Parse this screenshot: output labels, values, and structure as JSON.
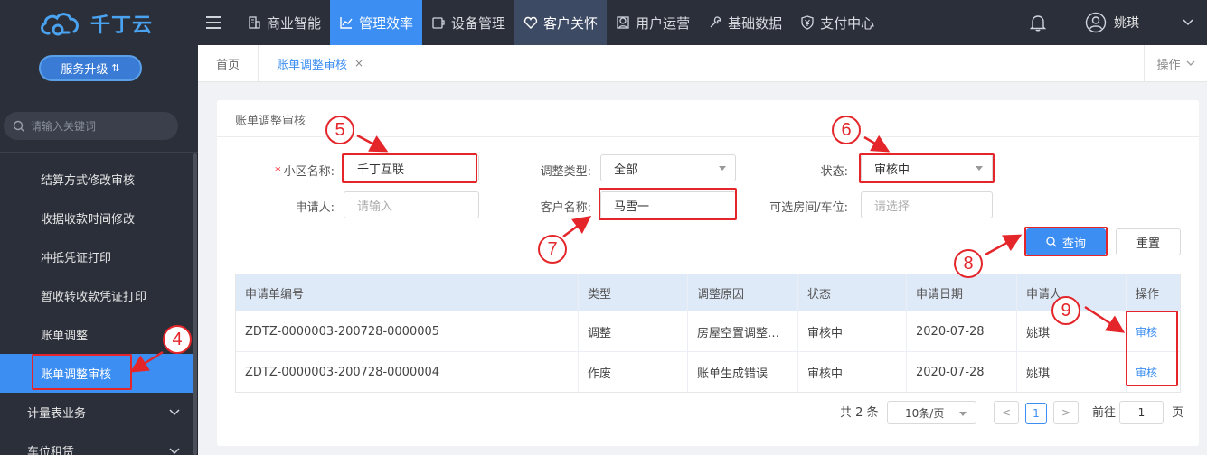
{
  "brand": {
    "logo_text": "千丁云",
    "upgrade_label": "服务升级"
  },
  "sidebar": {
    "search_placeholder": "请输入关键词",
    "items": [
      {
        "label": "结算方式修改审核"
      },
      {
        "label": "收据收款时间修改"
      },
      {
        "label": "冲抵凭证打印"
      },
      {
        "label": "暂收转收款凭证打印"
      },
      {
        "label": "账单调整"
      },
      {
        "label": "账单调整审核"
      }
    ],
    "groups": [
      {
        "label": "计量表业务"
      },
      {
        "label": "车位租赁"
      }
    ]
  },
  "topnav": {
    "items": [
      {
        "label": "商业智能",
        "icon": "building-icon"
      },
      {
        "label": "管理效率",
        "icon": "chart-icon"
      },
      {
        "label": "设备管理",
        "icon": "device-icon"
      },
      {
        "label": "客户关怀",
        "icon": "heart-icon"
      },
      {
        "label": "用户运营",
        "icon": "user-ops-icon"
      },
      {
        "label": "基础数据",
        "icon": "wrench-icon"
      },
      {
        "label": "支付中心",
        "icon": "yen-shield-icon"
      }
    ],
    "user_name": "姚琪"
  },
  "tabs": {
    "items": [
      {
        "label": "首页"
      },
      {
        "label": "账单调整审核",
        "close": "×"
      }
    ],
    "ops_label": "操作"
  },
  "card": {
    "title": "账单调整审核"
  },
  "form": {
    "required_mark": "*",
    "community_label": "小区名称:",
    "community_value": "千丁互联",
    "adjust_type_label": "调整类型:",
    "adjust_type_value": "全部",
    "status_label": "状态:",
    "status_value": "审核中",
    "applicant_label": "申请人:",
    "applicant_placeholder": "请输入",
    "customer_label": "客户名称:",
    "customer_value": "马雪一",
    "room_label": "可选房间/车位:",
    "room_placeholder": "请选择",
    "query_label": "查询",
    "reset_label": "重置"
  },
  "table": {
    "headers": [
      "申请单编号",
      "类型",
      "调整原因",
      "状态",
      "申请日期",
      "申请人",
      "操作"
    ],
    "rows": [
      [
        "ZDTZ-0000003-200728-0000005",
        "调整",
        "房屋空置调整…",
        "审核中",
        "2020-07-28",
        "姚琪",
        "审核"
      ],
      [
        "ZDTZ-0000003-200728-0000004",
        "作废",
        "账单生成错误",
        "审核中",
        "2020-07-28",
        "姚琪",
        "审核"
      ]
    ]
  },
  "pager": {
    "total": "共 2 条",
    "page_size": "10条/页",
    "prev": "<",
    "current": "1",
    "next": ">",
    "goto_prefix": "前往",
    "goto_value": "1",
    "goto_suffix": "页"
  },
  "annotations": [
    "4",
    "5",
    "6",
    "7",
    "8",
    "9"
  ],
  "colors": {
    "accent": "#3c8ef2",
    "highlight": "#e4262b",
    "sidebar": "#2b2f3a"
  }
}
